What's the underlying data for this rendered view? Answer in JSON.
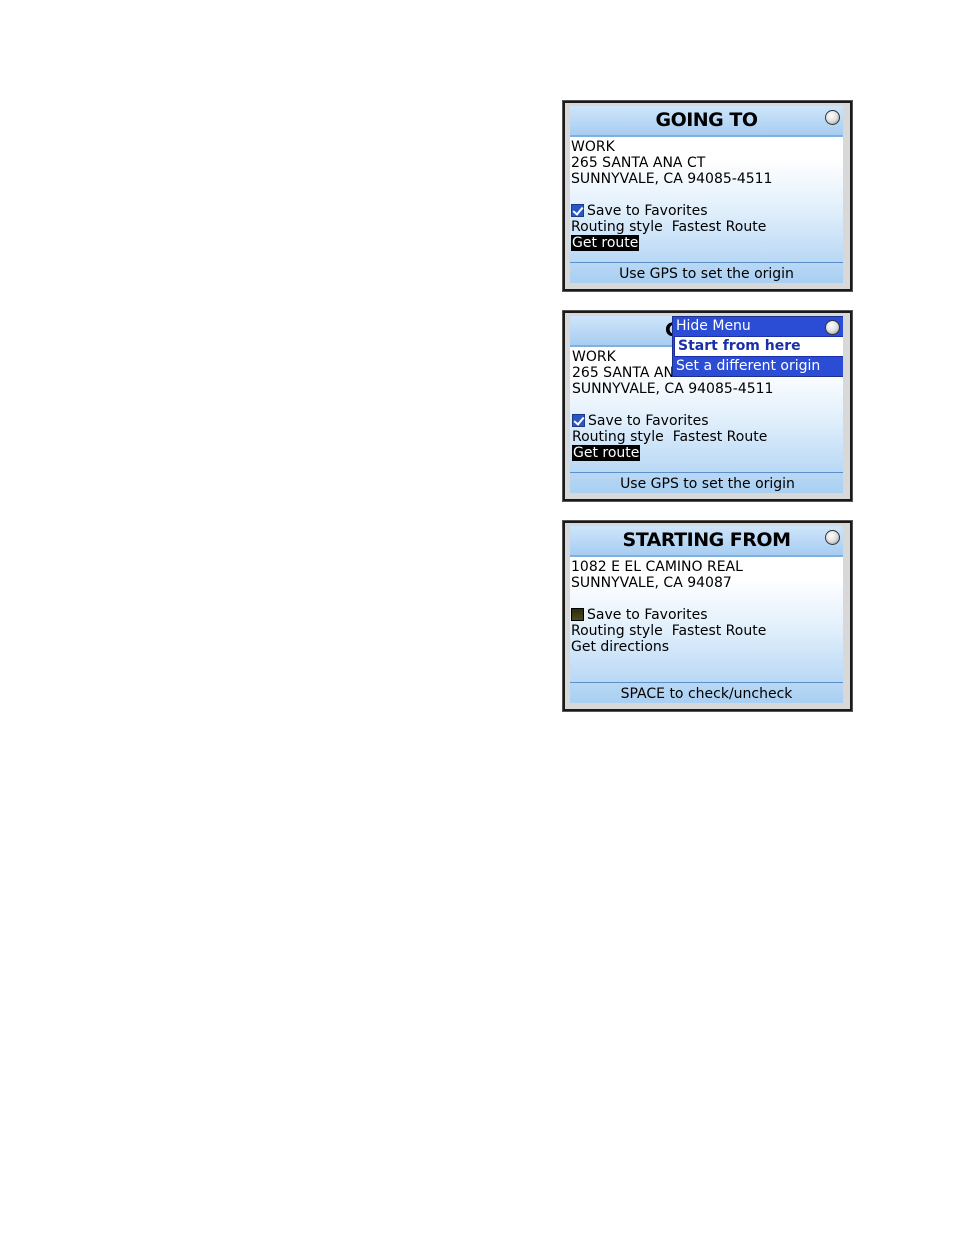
{
  "screen1": {
    "title": "GOING TO",
    "lines": [
      "WORK",
      "265 SANTA ANA CT",
      "SUNNYVALE, CA 94085-4511"
    ],
    "save_label": "Save to Favorites",
    "save_checked": true,
    "routing_label": "Routing style",
    "routing_value": "Fastest Route",
    "action_label": "Get route",
    "footer": "Use GPS to set the origin"
  },
  "screen2": {
    "title_partial": "G",
    "lines": [
      "WORK",
      "265 SANTA ANA",
      "SUNNYVALE, CA 94085-4511"
    ],
    "save_label": "Save to Favorites",
    "save_checked": true,
    "routing_label": "Routing style",
    "routing_value": "Fastest Route",
    "action_label": "Get route",
    "footer": "Use GPS to set the origin",
    "menu": {
      "items": [
        "Hide Menu",
        "Start from here",
        "Set a different origin"
      ],
      "selected_index": 1
    }
  },
  "screen3": {
    "title": "STARTING FROM",
    "lines": [
      "1082 E EL CAMINO REAL",
      "SUNNYVALE, CA 94087"
    ],
    "save_label": "Save to Favorites",
    "save_checked": false,
    "routing_label": "Routing style",
    "routing_value": "Fastest Route",
    "action_label": "Get directions",
    "footer": "SPACE to check/uncheck"
  }
}
